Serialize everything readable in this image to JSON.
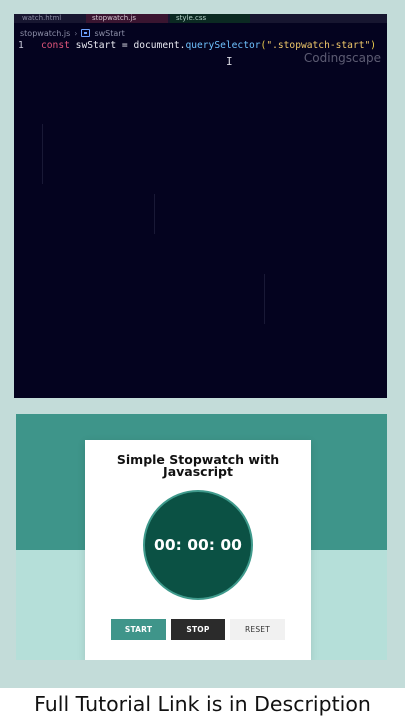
{
  "editor": {
    "tabs": [
      "watch.html",
      "stopwatch.js",
      "style.css"
    ],
    "breadcrumb": {
      "file": "stopwatch.js",
      "symbol": "swStart"
    },
    "code": {
      "line_number": "1",
      "keyword": "const",
      "variable": "swStart",
      "operator": "=",
      "object": "document.",
      "method": "querySelector",
      "paren_open": "(",
      "string": "\".stopwatch-start\"",
      "paren_close": ")"
    },
    "watermark": "Codingscape",
    "cursor_glyph": "I"
  },
  "preview": {
    "title": "Simple Stopwatch with Javascript",
    "time": "00: 00: 00",
    "buttons": {
      "start": "START",
      "stop": "STOP",
      "reset": "RESET"
    }
  },
  "caption": "Full Tutorial Link is in Description",
  "colors": {
    "page_bg": "#c3dcd9",
    "editor_bg": "#04031f",
    "accent_teal": "#3e958a",
    "clock_bg": "#0b5144",
    "stop_button": "#2b2b2b"
  }
}
